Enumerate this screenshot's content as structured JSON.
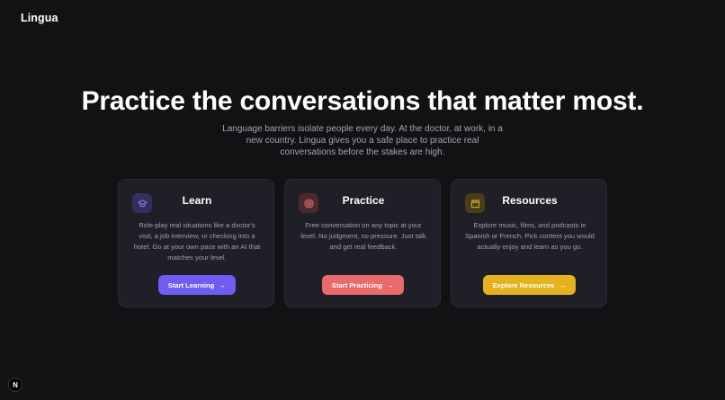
{
  "app": {
    "logo": "Lingua"
  },
  "hero": {
    "title": "Practice the conversations that matter most.",
    "subtitle": "Language barriers isolate people every day. At the doctor, at work, in a new country. Lingua gives you a safe place to practice real conversations before the stakes are high."
  },
  "cards": [
    {
      "title": "Learn",
      "icon": "graduation-cap-icon",
      "description": "Role-play real situations like a doctor's visit, a job interview, or checking into a hotel. Go at your own pace with an AI that matches your level.",
      "button_label": "Start Learning",
      "accent": "#6d5df0"
    },
    {
      "title": "Practice",
      "icon": "target-icon",
      "description": "Free conversation on any topic at your level. No judgment, no pressure. Just talk and get real feedback.",
      "button_label": "Start Practicing",
      "accent": "#ea6b6b"
    },
    {
      "title": "Resources",
      "icon": "film-clapper-icon",
      "description": "Explore music, films, and podcasts in Spanish or French. Pick content you would actually enjoy and learn as you go.",
      "button_label": "Explore Resources",
      "accent": "#e3b21d"
    }
  ],
  "arrow_glyph": "→",
  "dev_badge": {
    "label": "N",
    "icon": "next-logo-icon"
  },
  "colors": {
    "background": "#121215",
    "card": "#1f1f27",
    "text_muted": "#a3a3ac"
  }
}
